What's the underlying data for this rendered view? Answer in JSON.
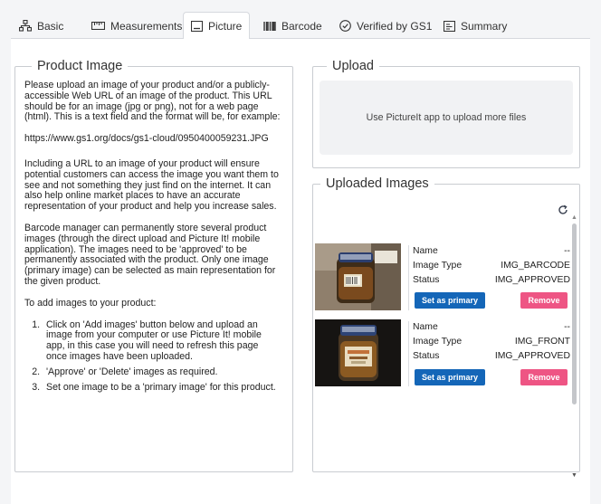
{
  "tabs": [
    {
      "label": "Basic",
      "icon": "sitemap-icon"
    },
    {
      "label": "Measurements",
      "icon": "ruler-icon"
    },
    {
      "label": "Picture",
      "icon": "picture-icon"
    },
    {
      "label": "Barcode",
      "icon": "barcode-icon"
    },
    {
      "label": "Verified by GS1",
      "icon": "check-circle-icon"
    },
    {
      "label": "Summary",
      "icon": "summary-icon"
    }
  ],
  "active_tab": "Picture",
  "product_image": {
    "legend": "Product Image",
    "paragraphs": [
      "Please upload an image of your product and/or a publicly-accessible Web URL of an image of the product. This URL should be for an image (jpg or png), not for a web page (html). This is a text field and the format will be, for example:",
      "https://www.gs1.org/docs/gs1-cloud/0950400059231.JPG",
      "Including a URL to an image of your product will ensure potential customers can access the image you want them to see and not something they just find on the internet. It can also help online market places to have an accurate representation of your product and help you increase sales.",
      "Barcode manager can permanently store several product images (through the direct upload and Picture It! mobile application). The images need to be 'approved' to be permanently associated with the product. Only one image (primary image) can be selected as main representation for the given product.",
      "To add images to your product:"
    ],
    "steps": [
      "Click on 'Add images' button below and upload an image from your computer or use Picture It! mobile app, in this case you will need to refresh this page once images have been uploaded.",
      "'Approve' or 'Delete' images as required.",
      "Set one image to be a 'primary image' for this product."
    ]
  },
  "upload": {
    "legend": "Upload",
    "message": "Use PictureIt app to upload more files"
  },
  "uploaded_images": {
    "legend": "Uploaded Images",
    "refresh_icon": "refresh-icon",
    "labels": {
      "name": "Name",
      "image_type": "Image Type",
      "status": "Status"
    },
    "set_primary_label": "Set as primary",
    "remove_label": "Remove",
    "items": [
      {
        "name": "--",
        "image_type": "IMG_BARCODE",
        "status": "IMG_APPROVED"
      },
      {
        "name": "--",
        "image_type": "IMG_FRONT",
        "status": "IMG_APPROVED"
      }
    ]
  },
  "colors": {
    "primary_button": "#1466b8",
    "remove_button": "#ee5584",
    "page_background": "#f4f5f7"
  }
}
